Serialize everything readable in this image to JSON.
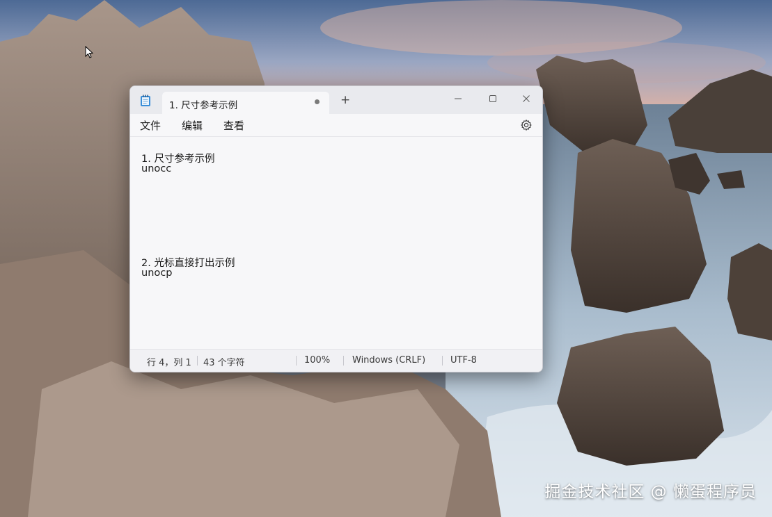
{
  "desktop": {
    "watermark": "掘金技术社区 @ 懒蛋程序员"
  },
  "window": {
    "tab_title": "1. 尺寸参考示例",
    "new_tab_label": "+",
    "menu": {
      "file": "文件",
      "edit": "编辑",
      "view": "查看"
    },
    "content_lines": [
      "1. 尺寸参考示例",
      "unocc",
      "2. 光标直接打出示例",
      "unocp"
    ],
    "status": {
      "position": "行 4，列 1",
      "chars": "43 个字符",
      "zoom": "100%",
      "line_ending": "Windows (CRLF)",
      "encoding": "UTF-8"
    }
  },
  "icons": {
    "app": "notepad-icon",
    "settings": "gear-icon",
    "minimize": "minimize-icon",
    "maximize": "maximize-icon",
    "close": "close-icon",
    "unsaved": "unsaved-dot-icon",
    "cursor": "mouse-cursor-icon"
  }
}
